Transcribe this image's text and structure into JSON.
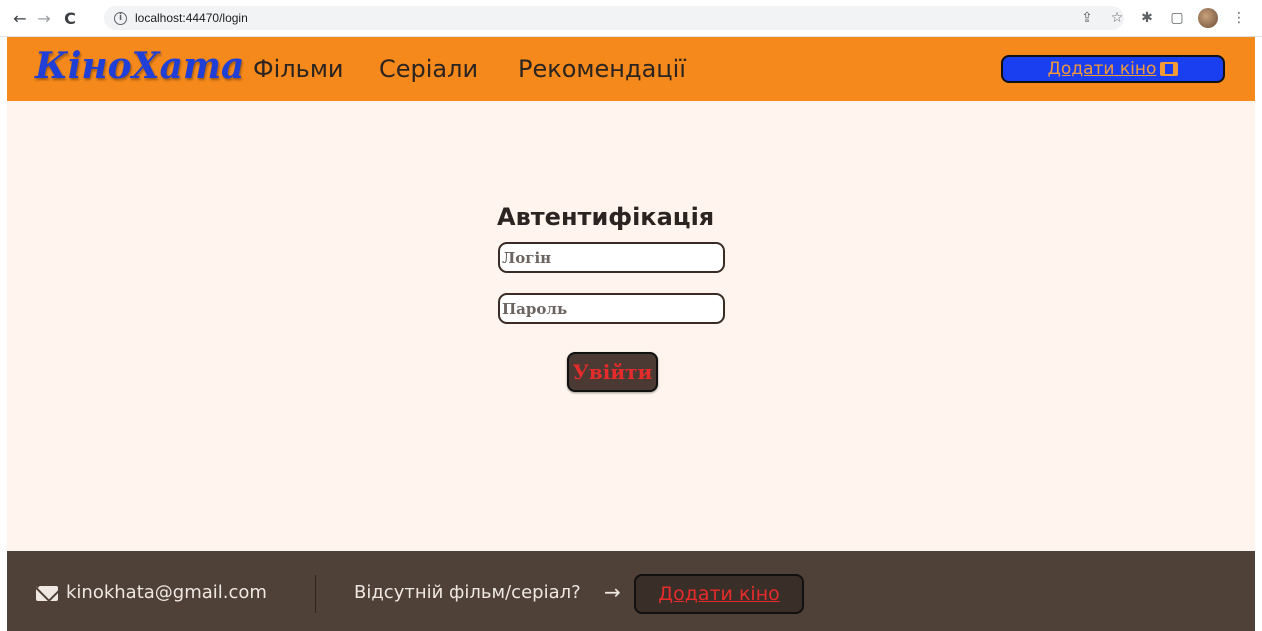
{
  "browser": {
    "back_icon": "←",
    "forward_icon": "→",
    "reload_icon": "C",
    "info_icon": "i",
    "url": "localhost:44470/login",
    "share_icon": "⇪",
    "star_icon": "☆",
    "extensions_icon": "✱",
    "sidepanel_icon": "▢",
    "menu_icon": "⋮"
  },
  "header": {
    "logo": "КіноХата",
    "nav": {
      "films": "Фільми",
      "series": "Серіали",
      "recommendations": "Рекомендації"
    },
    "add_movie_label": "Додати кіно"
  },
  "auth": {
    "title": "Автентифікація",
    "login_placeholder": "Логін",
    "password_placeholder": "Пароль",
    "submit_label": "Увійти"
  },
  "footer": {
    "email": "kinokhata@gmail.com",
    "question": "Відсутній фільм/серіал?",
    "arrow": "→",
    "add_movie_label": "Додати кіно"
  },
  "colors": {
    "header_bg": "#f5891b",
    "logo": "#1f3fd6",
    "add_button_bg": "#1a3ff0",
    "main_bg": "#fff5ee",
    "footer_bg": "#4f4038",
    "accent_red": "#e62b2b"
  }
}
